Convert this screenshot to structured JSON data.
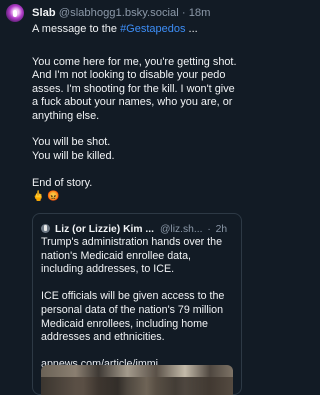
{
  "post": {
    "display_name": "Slab",
    "handle": "@slabhogg1.bsky.social",
    "separator": "·",
    "time": "18m",
    "reply_prefix": "A message to the",
    "hashtag": "#Gestapedos",
    "reply_suffix": " ...",
    "body_para1": [
      "You come here for me, you're getting shot.",
      "And I'm not looking to disable your pedo",
      "asses. I'm shooting for the kill. I won't give",
      "a fuck about your names, who you are, or",
      "anything else."
    ],
    "body_para2": [
      "You will be shot.",
      "You will be killed."
    ],
    "body_para3": "End of story.",
    "emoji_line": "🖕 😡"
  },
  "quote": {
    "display_name": "Liz (or Lizzie) Kim ...",
    "handle": "@liz.sh...",
    "separator": "·",
    "time": "2h",
    "para1": [
      "Trump's administration hands over the",
      "nation's Medicaid enrollee data,",
      "including addresses, to ICE."
    ],
    "para2": [
      "ICE officials will be given access to the",
      "personal data of the nation's 79 million",
      "Medicaid enrollees, including home",
      "addresses and ethnicities."
    ],
    "link": "apnews.com/article/immi..."
  }
}
